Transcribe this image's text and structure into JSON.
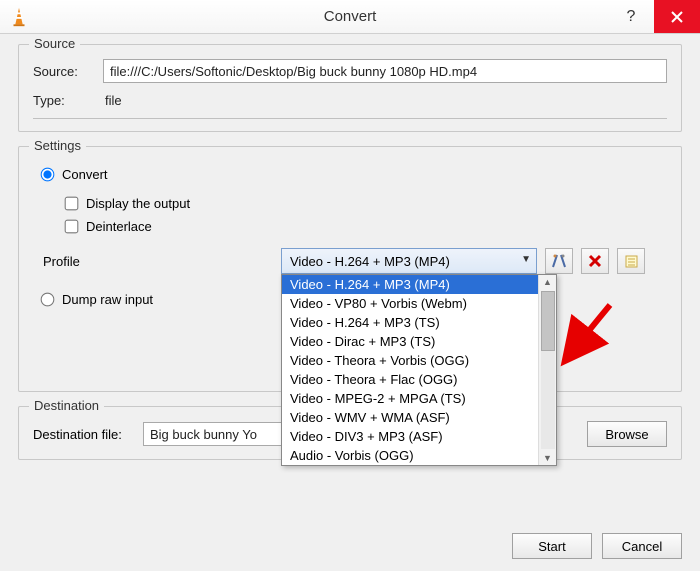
{
  "window": {
    "title": "Convert"
  },
  "source": {
    "legend": "Source",
    "source_label": "Source:",
    "source_value": "file:///C:/Users/Softonic/Desktop/Big buck bunny 1080p HD.mp4",
    "type_label": "Type:",
    "type_value": "file"
  },
  "settings": {
    "legend": "Settings",
    "convert_label": "Convert",
    "display_output_label": "Display the output",
    "deinterlace_label": "Deinterlace",
    "profile_label": "Profile",
    "profile_selected": "Video - H.264 + MP3 (MP4)",
    "profile_options": [
      "Video - H.264 + MP3 (MP4)",
      "Video - VP80 + Vorbis (Webm)",
      "Video - H.264 + MP3 (TS)",
      "Video - Dirac + MP3 (TS)",
      "Video - Theora + Vorbis (OGG)",
      "Video - Theora + Flac (OGG)",
      "Video - MPEG-2 + MPGA (TS)",
      "Video - WMV + WMA (ASF)",
      "Video - DIV3 + MP3 (ASF)",
      "Audio - Vorbis (OGG)"
    ],
    "dump_label": "Dump raw input"
  },
  "destination": {
    "legend": "Destination",
    "file_label": "Destination file:",
    "file_value": "Big buck bunny Yo",
    "browse_label": "Browse"
  },
  "buttons": {
    "start": "Start",
    "cancel": "Cancel"
  }
}
